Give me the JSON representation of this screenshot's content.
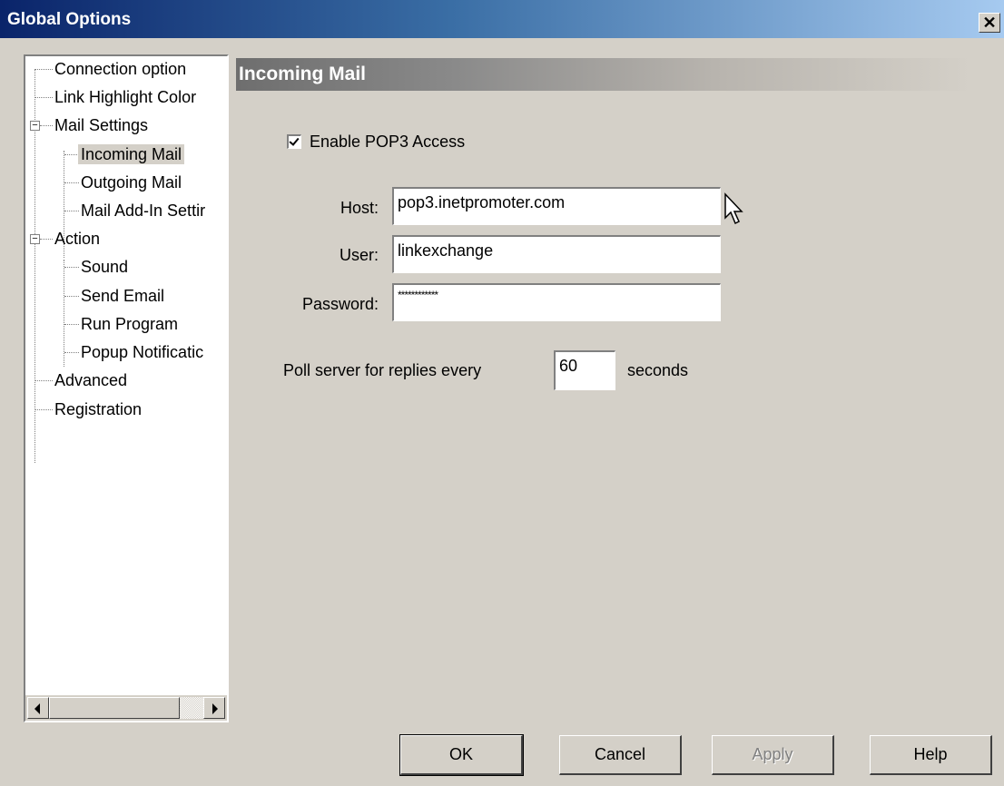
{
  "window": {
    "title": "Global Options",
    "close_glyph": "✕"
  },
  "tree": {
    "items": [
      {
        "label": "Connection option",
        "expander": null
      },
      {
        "label": "Link Highlight Color",
        "expander": null
      },
      {
        "label": "Mail Settings",
        "expander": "−"
      },
      {
        "label": "Incoming Mail",
        "expander": null,
        "selected": true
      },
      {
        "label": "Outgoing Mail",
        "expander": null
      },
      {
        "label": "Mail Add-In Settir",
        "expander": null
      },
      {
        "label": "Action",
        "expander": "−"
      },
      {
        "label": "Sound",
        "expander": null
      },
      {
        "label": "Send Email",
        "expander": null
      },
      {
        "label": "Run Program",
        "expander": null
      },
      {
        "label": "Popup Notificatic",
        "expander": null
      },
      {
        "label": "Advanced",
        "expander": null
      },
      {
        "label": "Registration",
        "expander": null
      }
    ]
  },
  "panel": {
    "header": "Incoming Mail",
    "enable_pop3": {
      "label": "Enable POP3 Access",
      "checked": true
    },
    "host": {
      "label": "Host:",
      "value": "pop3.inetpromoter.com"
    },
    "user": {
      "label": "User:",
      "value": "linkexchange"
    },
    "password": {
      "label": "Password:",
      "value": "************"
    },
    "poll": {
      "prefix": "Poll server for replies every",
      "value": "60",
      "suffix": "seconds"
    }
  },
  "buttons": {
    "ok": "OK",
    "cancel": "Cancel",
    "apply": "Apply",
    "help": "Help"
  },
  "colors": {
    "titlebar_start": "#0a246a",
    "titlebar_end": "#a6caf0",
    "face": "#d4d0c8"
  }
}
